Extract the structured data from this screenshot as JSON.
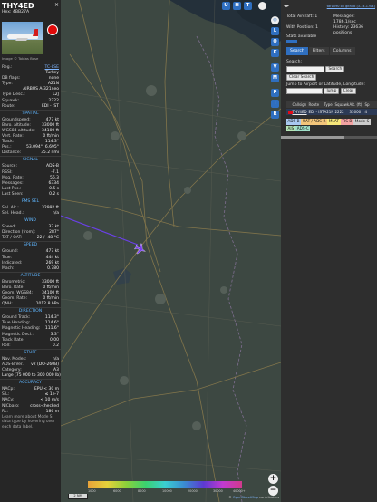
{
  "aircraft": {
    "callsign": "THY4ED",
    "hex": "Hex: 4BB27A",
    "photo_credit": "Image © Tobias Bose",
    "close": "×"
  },
  "left_rows_top": [
    {
      "k": "Reg.:",
      "v": "TC-LSE",
      "link": true
    },
    {
      "k": "",
      "v": "Turkey"
    },
    {
      "k": "DB flags:",
      "v": "none"
    },
    {
      "k": "Type:",
      "v": "A21N"
    },
    {
      "k": "",
      "v": "AIRBUS A-321neo"
    },
    {
      "k": "Type Desc.:",
      "v": "L2J"
    },
    {
      "k": "Squawk:",
      "v": "2222"
    },
    {
      "k": "Route:",
      "v": "EDI - IST"
    }
  ],
  "sections": [
    {
      "title": "SPATIAL",
      "rows": [
        {
          "k": "Groundspeed:",
          "v": "477 kt"
        },
        {
          "k": "Baro. altitude:",
          "v": "33000 ft"
        },
        {
          "k": "WGS84 altitude:",
          "v": "34100 ft"
        },
        {
          "k": "Vert. Rate:",
          "v": "0 ft/min"
        },
        {
          "k": "Track:",
          "v": "114.3°"
        },
        {
          "k": "Pos.:",
          "v": "53.094°, 6.695°"
        },
        {
          "k": "Distance:",
          "v": "35.2 nmi"
        }
      ]
    },
    {
      "title": "SIGNAL",
      "rows": [
        {
          "k": "Source:",
          "v": "ADS-B"
        },
        {
          "k": "RSSI:",
          "v": "-7.1"
        },
        {
          "k": "Msg. Rate:",
          "v": "56.3"
        },
        {
          "k": "Messages:",
          "v": "6334"
        },
        {
          "k": "Last Pos.:",
          "v": "0.5 s"
        },
        {
          "k": "Last Seen:",
          "v": "0.2 s"
        }
      ]
    },
    {
      "title": "FMS SEL",
      "rows": [
        {
          "k": "Sel. Alt.:",
          "v": "32992 ft"
        },
        {
          "k": "Sel. Head.:",
          "v": "n/a"
        }
      ]
    },
    {
      "title": "WIND",
      "rows": [
        {
          "k": "Speed:",
          "v": "33 kt"
        },
        {
          "k": "Direction (from):",
          "v": "287°"
        },
        {
          "k": "TAT / OAT:",
          "v": "-22 / -48 °C"
        }
      ]
    },
    {
      "title": "SPEED",
      "rows": [
        {
          "k": "Ground:",
          "v": "477 kt"
        },
        {
          "k": "True:",
          "v": "444 kt"
        },
        {
          "k": "Indicated:",
          "v": "269 kt"
        },
        {
          "k": "Mach:",
          "v": "0.780"
        }
      ]
    },
    {
      "title": "ALTITUDE",
      "rows": [
        {
          "k": "Barometric:",
          "v": "33000 ft"
        },
        {
          "k": "Baro. Rate:",
          "v": "0 ft/min"
        },
        {
          "k": "Geom. WGS84:",
          "v": "34100 ft"
        },
        {
          "k": "Geom. Rate:",
          "v": "0 ft/min"
        },
        {
          "k": "QNH:",
          "v": "1012.8 hPa"
        }
      ]
    },
    {
      "title": "DIRECTION",
      "rows": [
        {
          "k": "Ground Track:",
          "v": "114.3°"
        },
        {
          "k": "True Heading:",
          "v": "114.6°"
        },
        {
          "k": "Magnetic Heading:",
          "v": "111.6°"
        },
        {
          "k": "Magnetic Decl.:",
          "v": "3.3°"
        },
        {
          "k": "Track Rate:",
          "v": "0.00"
        },
        {
          "k": "Roll:",
          "v": "0.2"
        }
      ]
    },
    {
      "title": "STUFF",
      "rows": [
        {
          "k": "Nav. Modes:",
          "v": "n/a"
        },
        {
          "k": "ADS-B Ver.:",
          "v": "v2 (DO-260B)"
        },
        {
          "k": "Category:",
          "v": "A3"
        },
        {
          "k": "",
          "v": "Large (75 000 to 300 000 lb)"
        }
      ]
    },
    {
      "title": "ACCURACY",
      "rows": [
        {
          "k": "NACp:",
          "v": "EPU < 30 m"
        },
        {
          "k": "SIL:",
          "v": "≤ 1e-7"
        },
        {
          "k": "NACv:",
          "v": "< 10 m/s"
        },
        {
          "k": "NICbaro:",
          "v": "cross-checked"
        },
        {
          "k": "Rc:",
          "v": "186 m"
        }
      ]
    }
  ],
  "note": "Learn more about Mode S data type by hovering over each data label.",
  "map": {
    "top_buttons": [
      "U",
      "H",
      "T"
    ],
    "side_buttons": [
      "L",
      "O",
      "K",
      "V",
      "M",
      "P",
      "I",
      "R"
    ],
    "zoom_in": "+",
    "zoom_out": "−",
    "scale": "2 NM",
    "alt_labels": [
      "1000",
      "6000",
      "8000",
      "10000",
      "20000",
      "30000",
      "40000+"
    ],
    "attribution_prefix": "©",
    "attribution_link": "OpenStreetMap",
    "attribution_suffix": "contributors"
  },
  "right": {
    "arrows": "◂▸",
    "version": "tar1090 on github (3.14.1704)",
    "total_aircraft": "Total Aircraft: 1",
    "with_position": "With Position: 1",
    "stats_available": "Stats available",
    "messages": "Messages:",
    "messages_value": "1786.1/sec",
    "history": "History: 23636",
    "history_unit": "positions",
    "tabs": [
      "Search",
      "Filters",
      "Columns"
    ],
    "search_label": "Search:",
    "search_button": "Search",
    "clear_search": "Clear Search",
    "jump_label": "Jump to Airport or Latitude, Longitude:",
    "jump_button": "Jump",
    "clear_button": "Clear",
    "table_headers": [
      "Callsign",
      "Route",
      "Type",
      "Squawk",
      "Alt. (ft)",
      "Sp"
    ],
    "table_row": [
      "THY4ED",
      "EDI - IST",
      "A21N",
      "2222",
      "33000",
      "4"
    ],
    "chips": [
      {
        "label": "ADS-B",
        "color": "#a9c8f0"
      },
      {
        "label": "UAT / ADS-R",
        "color": "#f3c57b"
      },
      {
        "label": "MLAT",
        "color": "#f6e67a"
      },
      {
        "label": "TIS-B",
        "color": "#f3a3a3"
      },
      {
        "label": "Mode-S",
        "color": "#cccccc"
      },
      {
        "label": "AIS",
        "color": "#b7e6b7"
      },
      {
        "label": "ADS-C",
        "color": "#9fe0c9"
      }
    ]
  },
  "colors": {
    "accent": "#2f6fc0",
    "section": "#5fb6ff",
    "trail": "#6a40e6",
    "aircraft": "#7a3ef0"
  }
}
